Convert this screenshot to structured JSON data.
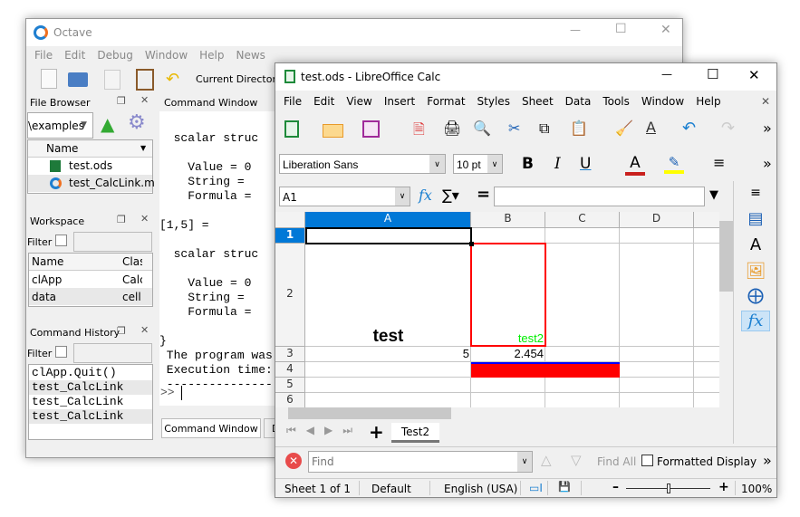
{
  "octave": {
    "title": "Octave",
    "menu": [
      "File",
      "Edit",
      "Debug",
      "Window",
      "Help",
      "News"
    ],
    "current_directory_label": "Current Directory:",
    "file_browser": {
      "title": "File Browser",
      "path": "\\examples",
      "column": "Name",
      "files": [
        "test.ods",
        "test_CalcLink.m"
      ]
    },
    "workspace": {
      "title": "Workspace",
      "filter_label": "Filter",
      "columns": [
        "Name",
        "Class"
      ],
      "rows": [
        [
          "clApp",
          "Calc"
        ],
        [
          "data",
          "cell"
        ]
      ]
    },
    "history": {
      "title": "Command History",
      "filter_label": "Filter",
      "items": [
        "clApp.Quit()",
        "test_CalcLink",
        "test_CalcLink",
        "test_CalcLink"
      ]
    },
    "command_window": {
      "title": "Command Window",
      "lines": [
        "",
        "  scalar struc",
        "",
        "    Value = 0",
        "    String =",
        "    Formula =",
        "",
        "[1,5] =",
        "",
        "  scalar struc",
        "",
        "    Value = 0",
        "    String =",
        "    Formula =",
        "",
        "}",
        " The program was",
        " Execution time:",
        " ---------------"
      ],
      "prompt": ">>",
      "tabs": [
        "Command Window",
        "D"
      ]
    }
  },
  "calc": {
    "title": "test.ods - LibreOffice Calc",
    "menu": [
      "File",
      "Edit",
      "View",
      "Insert",
      "Format",
      "Styles",
      "Sheet",
      "Data",
      "Tools",
      "Window",
      "Help"
    ],
    "font_name": "Liberation Sans",
    "font_size": "10 pt",
    "name_box": "A1",
    "formula": "",
    "columns": [
      "A",
      "B",
      "C",
      "D"
    ],
    "rows": [
      "1",
      "2",
      "3",
      "4",
      "5",
      "6"
    ],
    "cells": {
      "A2": "test",
      "B2": "test2",
      "A3": "5",
      "B3": "2.454"
    },
    "colors": {
      "selection": "#0078d7",
      "red": "#ff0000",
      "green": "#00ee00",
      "blue": "#0000ff"
    },
    "sheet_tab": "Test2",
    "find": {
      "placeholder": "Find",
      "find_all": "Find All",
      "formatted_display": "Formatted Display"
    },
    "status": {
      "sheet": "Sheet 1 of 1",
      "style": "Default",
      "language": "English (USA)",
      "zoom": "100%"
    }
  }
}
